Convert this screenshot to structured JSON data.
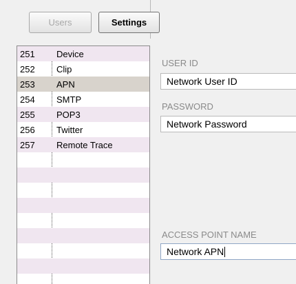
{
  "toolbar": {
    "users_label": "Users",
    "settings_label": "Settings"
  },
  "list": {
    "rows": [
      {
        "num": "251",
        "label": "Device"
      },
      {
        "num": "252",
        "label": "Clip"
      },
      {
        "num": "253",
        "label": "APN"
      },
      {
        "num": "254",
        "label": "SMTP"
      },
      {
        "num": "255",
        "label": "POP3"
      },
      {
        "num": "256",
        "label": "Twitter"
      },
      {
        "num": "257",
        "label": "Remote Trace"
      }
    ],
    "selected_index": 2
  },
  "form": {
    "user_id": {
      "label": "USER ID",
      "value": "Network User ID"
    },
    "password": {
      "label": "PASSWORD",
      "value": "Network Password"
    },
    "apn": {
      "label": "ACCESS POINT NAME",
      "value": "Network APN"
    }
  }
}
